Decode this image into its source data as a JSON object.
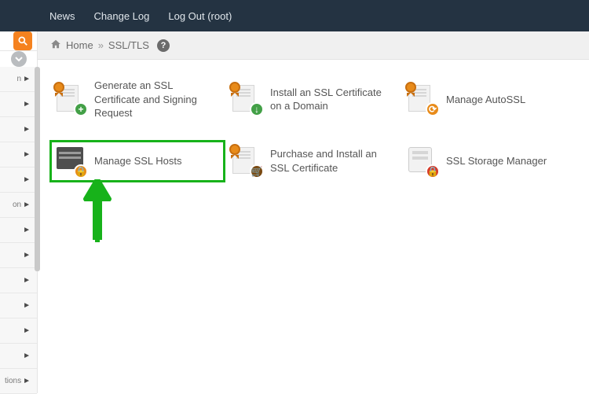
{
  "topnav": {
    "news": "News",
    "changelog": "Change Log",
    "logout": "Log Out (root)"
  },
  "breadcrumb": {
    "home": "Home",
    "current": "SSL/TLS"
  },
  "sidebar": {
    "items": [
      {
        "suffix": "n"
      },
      {
        "suffix": ""
      },
      {
        "suffix": ""
      },
      {
        "suffix": ""
      },
      {
        "suffix": ""
      },
      {
        "suffix": "on"
      },
      {
        "suffix": ""
      },
      {
        "suffix": ""
      },
      {
        "suffix": ""
      },
      {
        "suffix": ""
      },
      {
        "suffix": ""
      },
      {
        "suffix": ""
      },
      {
        "suffix": "tions"
      }
    ]
  },
  "tiles": {
    "generate_csr": "Generate an SSL Certificate and Signing Request",
    "install_domain": "Install an SSL Certificate on a Domain",
    "manage_autossl": "Manage AutoSSL",
    "manage_hosts": "Manage SSL Hosts",
    "purchase": "Purchase and Install an SSL Certificate",
    "storage": "SSL Storage Manager"
  },
  "highlight_target": "manage_hosts",
  "colors": {
    "highlight": "#17b21a",
    "brand_orange": "#f5821f",
    "navbar": "#243342"
  }
}
